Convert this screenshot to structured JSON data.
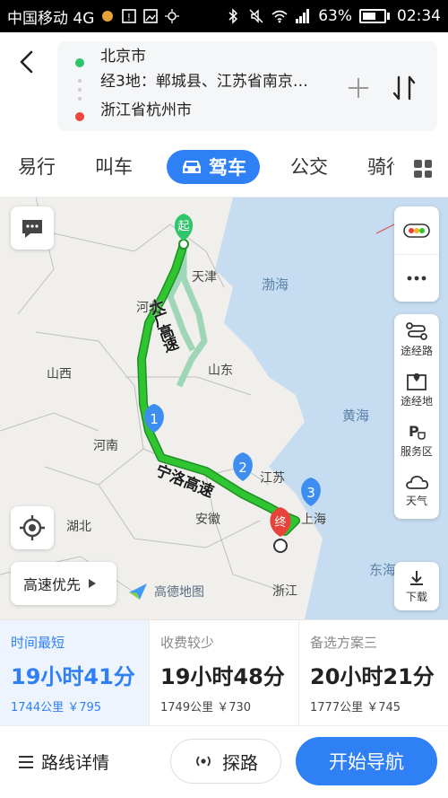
{
  "status_bar": {
    "carrier": "中国移动 4G",
    "battery": "63%",
    "battery_level": 0.63,
    "time": "02:34"
  },
  "route": {
    "origin": "北京市",
    "waypoints": "经3地：郸城县、江苏省南京…",
    "destination": "浙江省杭州市",
    "origin_color": "#2ec56b",
    "destination_color": "#f0453a"
  },
  "tabs": {
    "items": [
      "易行",
      "叫车",
      "驾车",
      "公交",
      "骑行"
    ],
    "active": "驾车",
    "accent": "#2f7ff5"
  },
  "map": {
    "labels": {
      "tianjin": "天津",
      "bohai": "渤海",
      "hebei": "河北",
      "shanxi": "山西",
      "shandong": "山东",
      "huanghai": "黄海",
      "henan": "河南",
      "jiangsu": "江苏",
      "hubei": "湖北",
      "anhui": "安徽",
      "shanghai": "上海",
      "donghai": "东海",
      "zhejiang": "浙江"
    },
    "highway_name_1": "大广高速",
    "highway_name_2": "宁洛高速",
    "start_marker": "起",
    "end_marker": "终",
    "waypoint_markers": [
      "1",
      "2",
      "3"
    ],
    "route_color": "#2ec530",
    "alt_route_color": "#9fd6b8",
    "waypoint_color": "#3d8ef0"
  },
  "right_panel": {
    "waypoint_route": "途经路",
    "waypoint_place": "途经地",
    "service_area": "服务区",
    "weather": "天气",
    "download": "下载"
  },
  "highway_priority": "高速优先",
  "logo_text": "高德地图",
  "options": [
    {
      "tag": "时间最短",
      "time": "19小时41分",
      "distance": "1744公里",
      "toll": "￥795"
    },
    {
      "tag": "收费较少",
      "time": "19小时48分",
      "distance": "1749公里",
      "toll": "￥730"
    },
    {
      "tag": "备选方案三",
      "time": "20小时21分",
      "distance": "1777公里",
      "toll": "￥745"
    }
  ],
  "bottom": {
    "route_details": "路线详情",
    "explore": "探路",
    "start_navigation": "开始导航"
  }
}
